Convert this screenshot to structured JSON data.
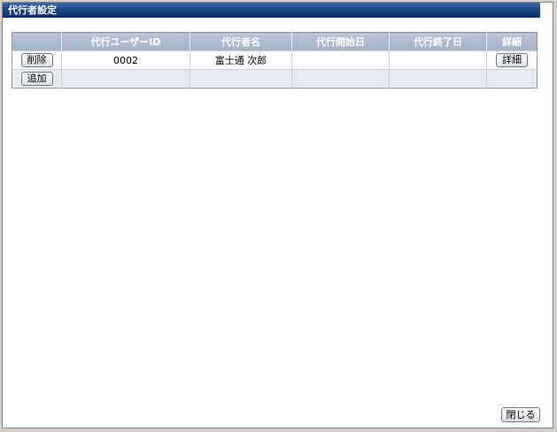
{
  "window": {
    "title": "代行者設定"
  },
  "table": {
    "headers": [
      "",
      "代行ユーザーID",
      "代行者名",
      "代行開始日",
      "代行終了日",
      "詳細"
    ],
    "rows": [
      {
        "delete_label": "削除",
        "user_id": "0002",
        "name": "富士通 次郎",
        "start_date": "",
        "end_date": "",
        "detail_label": "詳細"
      }
    ],
    "add_label": "追加"
  },
  "footer": {
    "close_label": "閉じる"
  }
}
